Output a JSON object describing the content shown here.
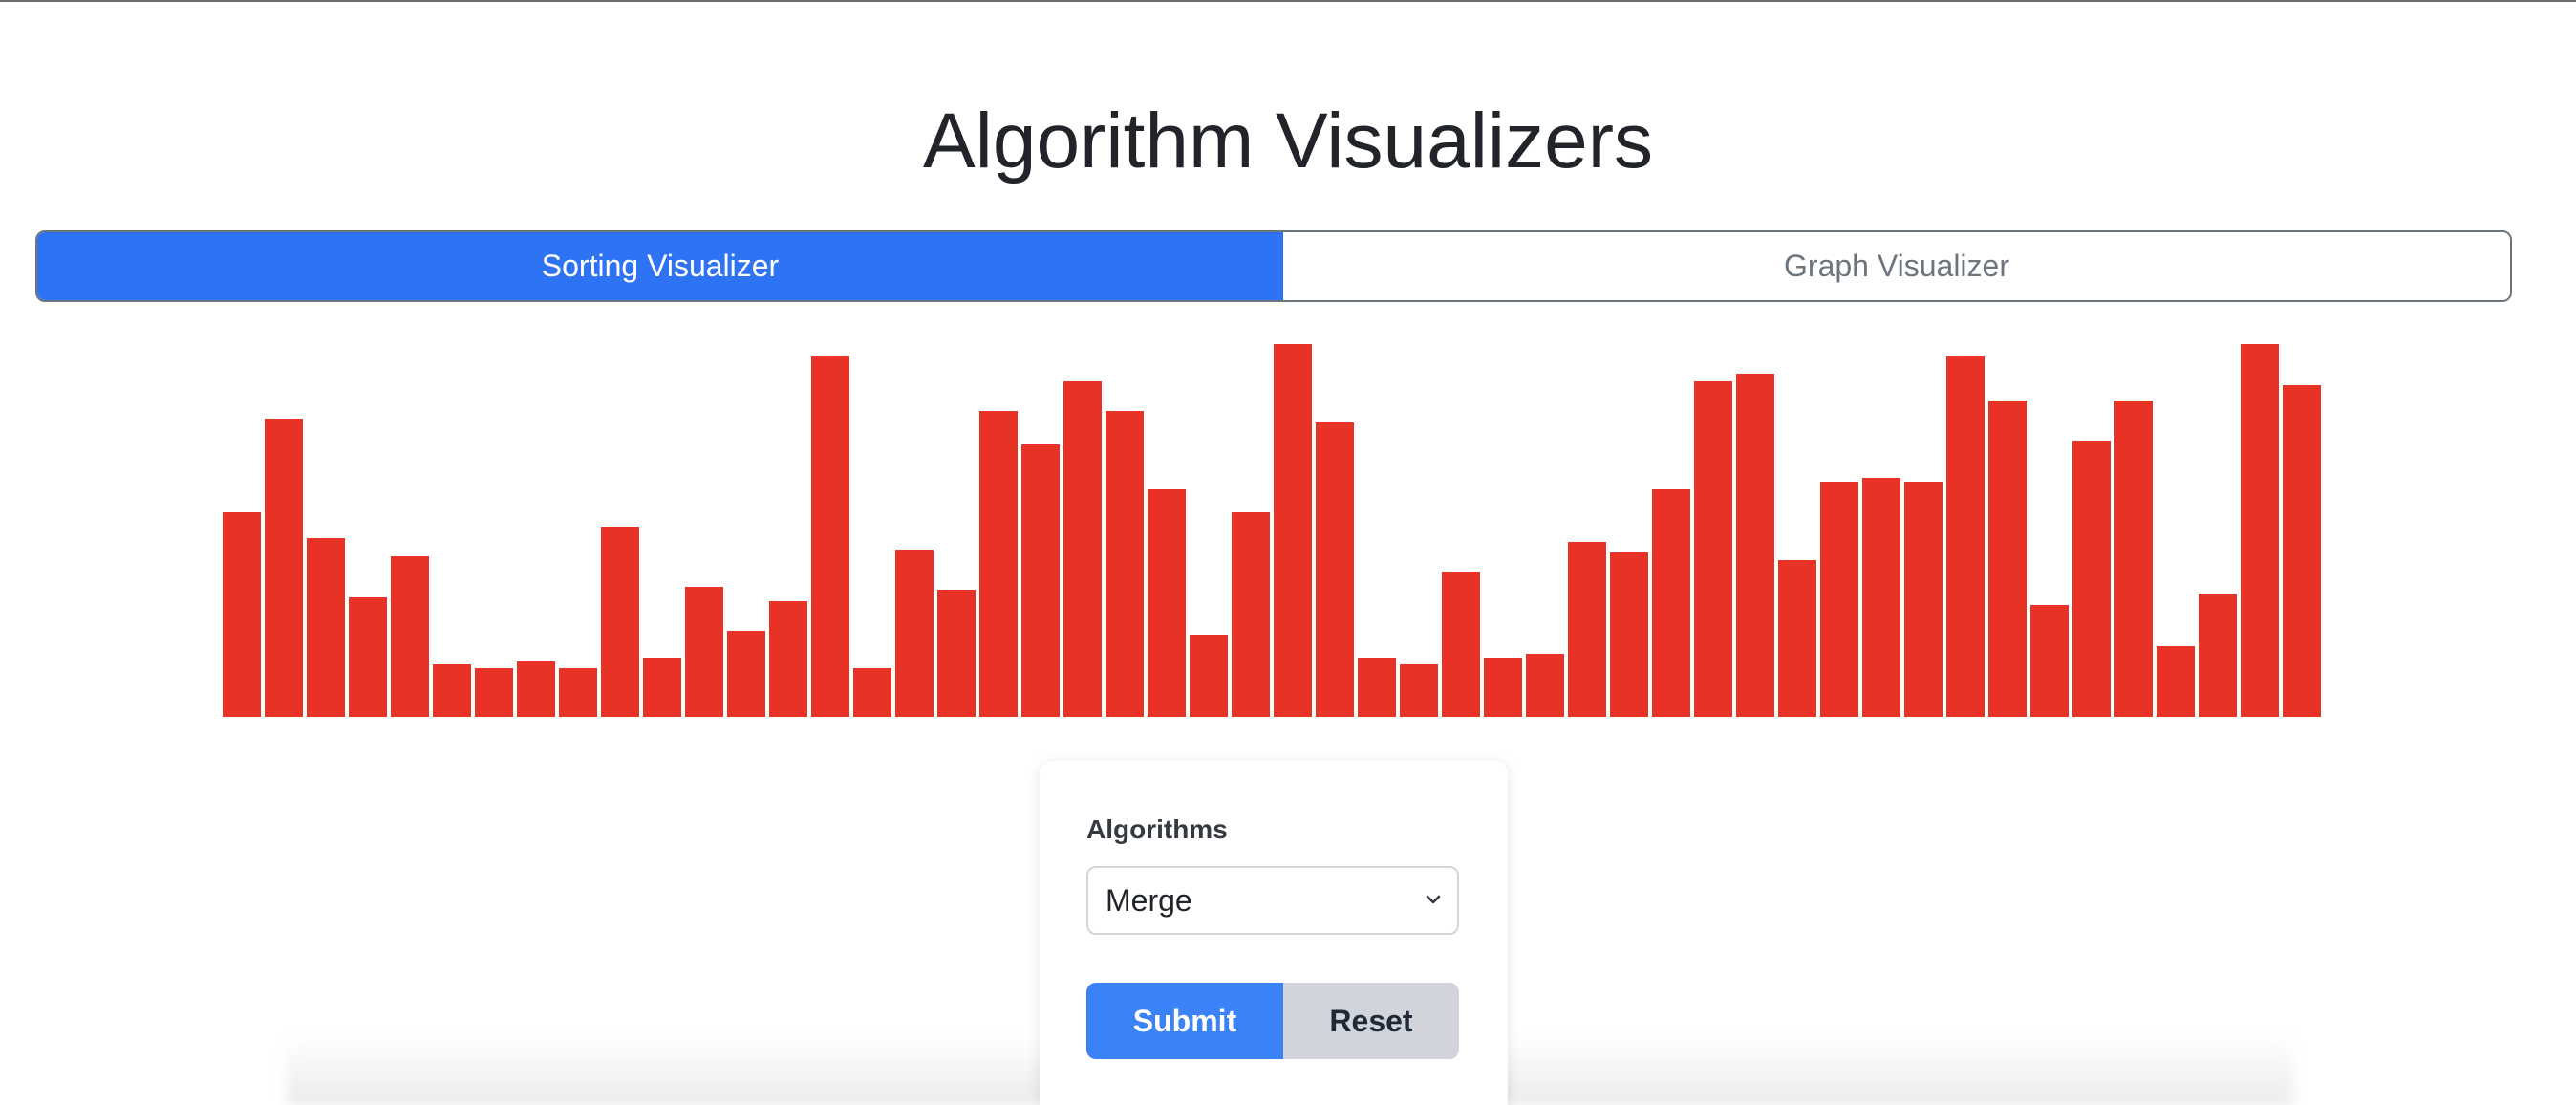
{
  "page": {
    "title": "Algorithm Visualizers"
  },
  "tabs": [
    {
      "label": "Sorting Visualizer",
      "active": true
    },
    {
      "label": "Graph Visualizer",
      "active": false
    }
  ],
  "colors": {
    "active_tab": "#2f73f5",
    "bar": "#e83226",
    "submit": "#3b82f6",
    "reset": "#d1d5db"
  },
  "chart_data": {
    "type": "bar",
    "values": [
      55,
      80,
      48,
      32,
      43,
      14,
      13,
      15,
      13,
      51,
      16,
      35,
      23,
      31,
      97,
      13,
      45,
      34,
      82,
      73,
      90,
      82,
      61,
      22,
      55,
      100,
      79,
      16,
      14,
      39,
      16,
      17,
      47,
      44,
      61,
      90,
      92,
      42,
      63,
      64,
      63,
      97,
      85,
      30,
      74,
      85,
      19,
      33,
      100,
      89
    ],
    "ylim": [
      0,
      100
    ],
    "grid": false,
    "legend": "none"
  },
  "controls": {
    "algorithms_label": "Algorithms",
    "selected_algorithm": "Merge",
    "submit_label": "Submit",
    "reset_label": "Reset"
  },
  "icons": {
    "select_chevron": "chevron-down-icon"
  }
}
